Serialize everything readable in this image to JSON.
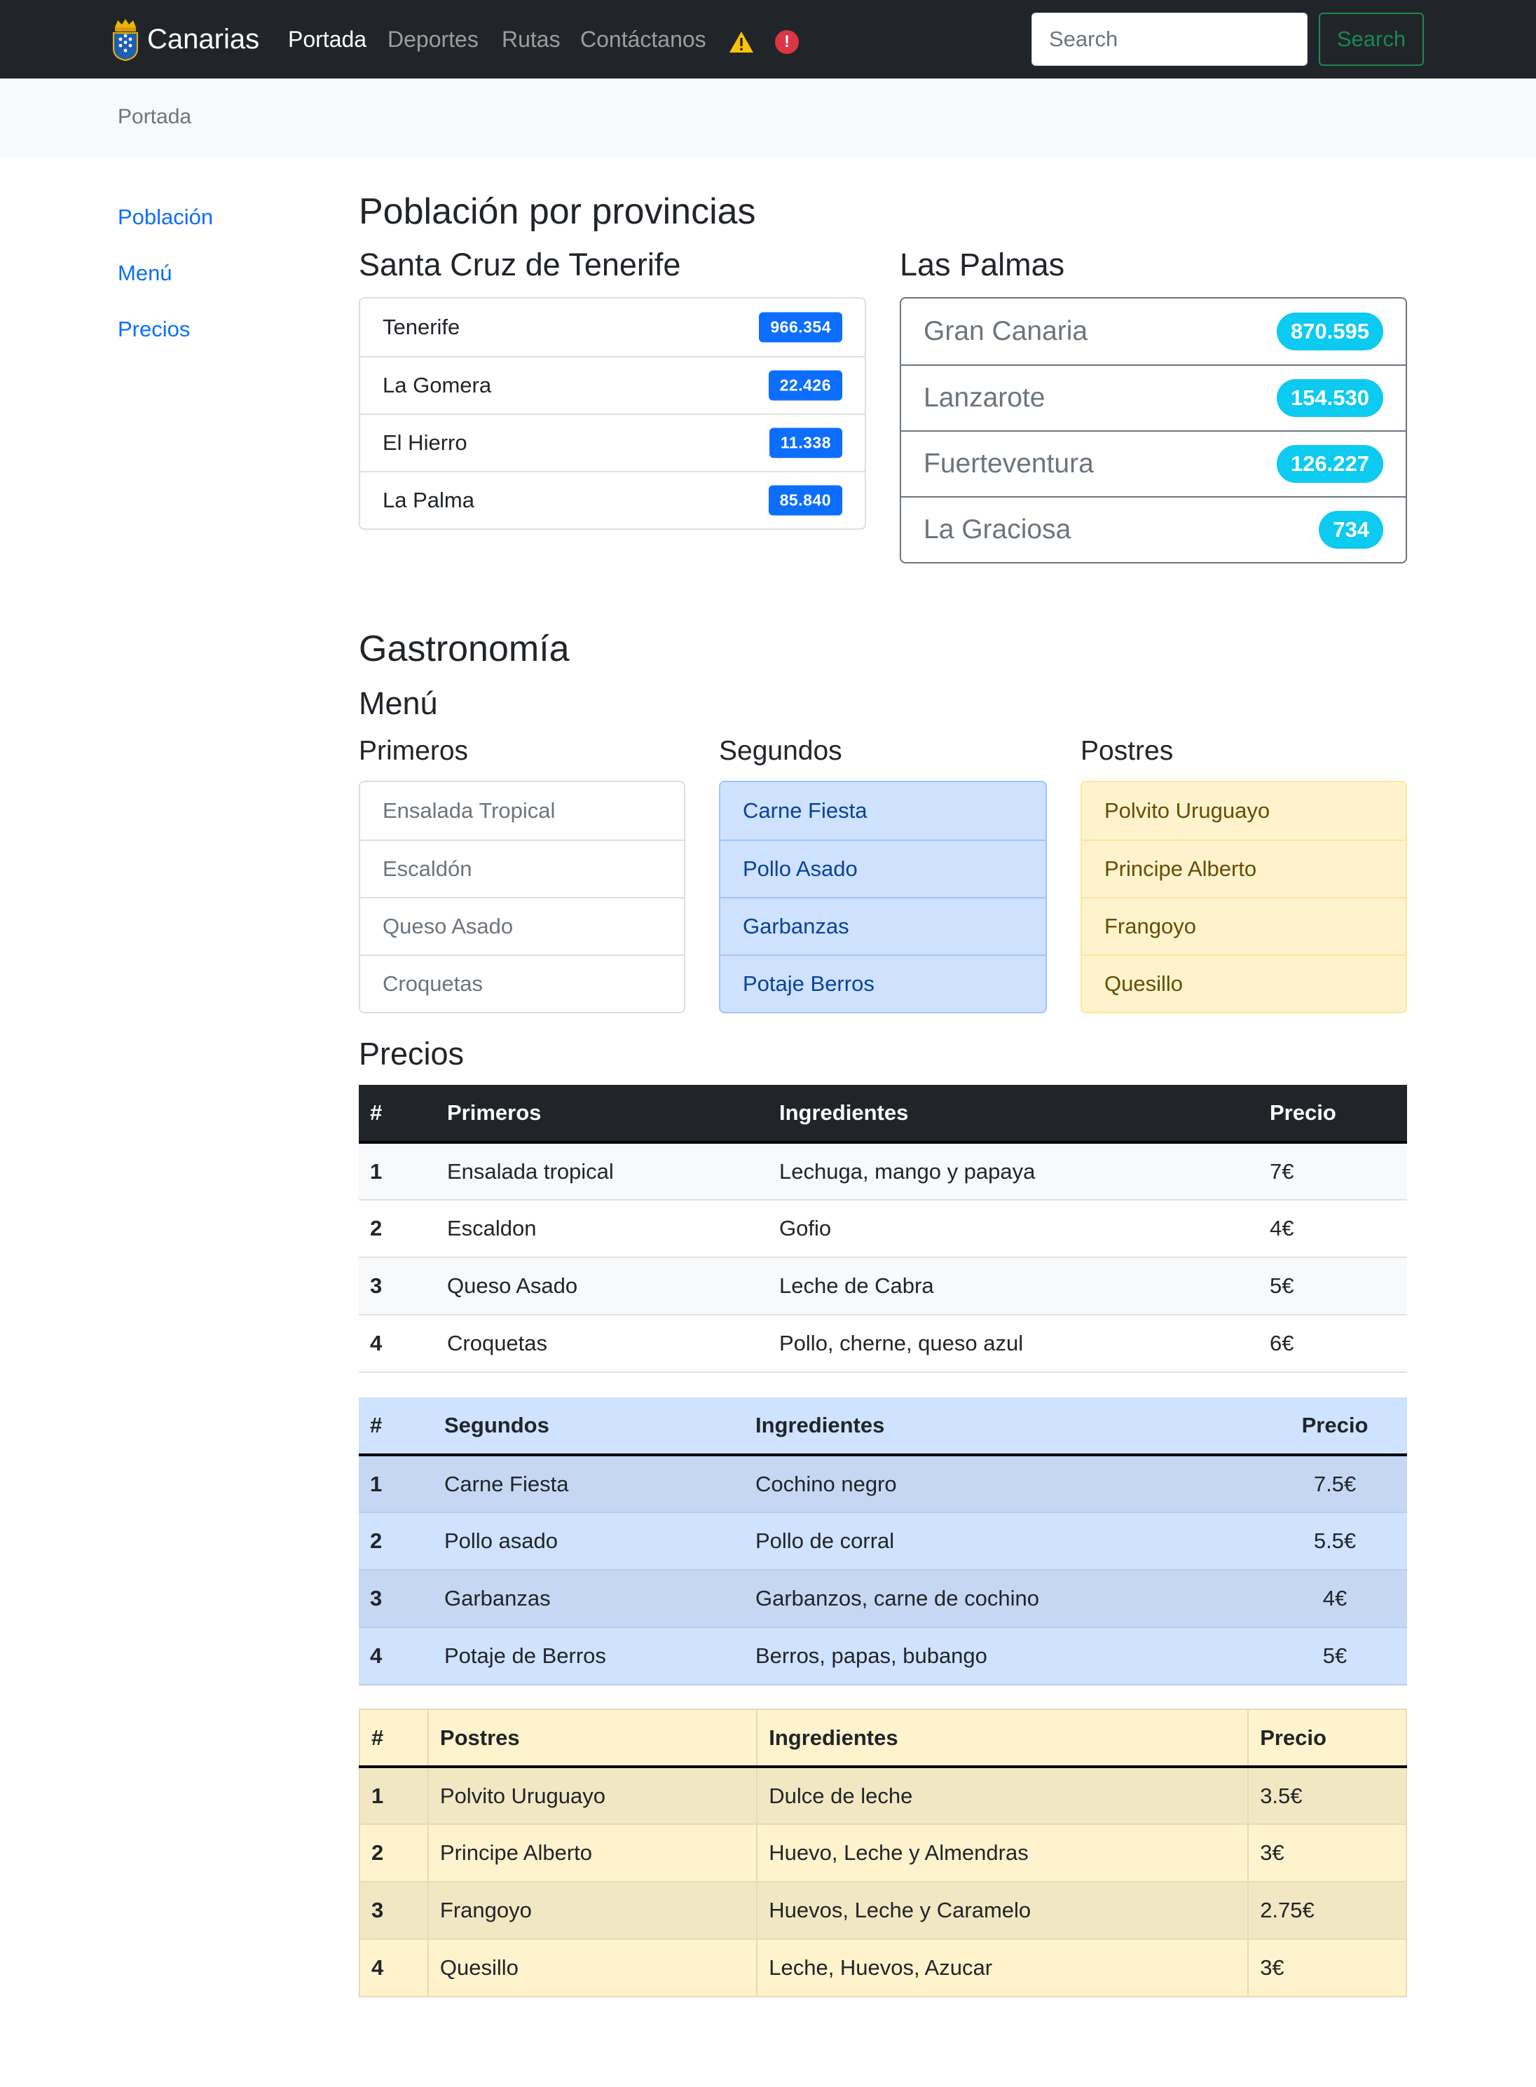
{
  "navbar": {
    "brand": "Canarias",
    "links": [
      "Portada",
      "Deportes",
      "Rutas",
      "Contáctanos"
    ],
    "search_placeholder": "Search",
    "search_button": "Search"
  },
  "breadcrumb": {
    "current": "Portada"
  },
  "sidebar": {
    "items": [
      "Población",
      "Menú",
      "Precios"
    ]
  },
  "poblacion": {
    "title": "Población por provincias",
    "provinces": [
      {
        "name": "Santa Cruz de Tenerife",
        "islands": [
          {
            "name": "Tenerife",
            "value": "966.354"
          },
          {
            "name": "La Gomera",
            "value": "22.426"
          },
          {
            "name": "El Hierro",
            "value": "11.338"
          },
          {
            "name": "La Palma",
            "value": "85.840"
          }
        ]
      },
      {
        "name": "Las Palmas",
        "islands": [
          {
            "name": "Gran Canaria",
            "value": "870.595"
          },
          {
            "name": "Lanzarote",
            "value": "154.530"
          },
          {
            "name": "Fuerteventura",
            "value": "126.227"
          },
          {
            "name": "La Graciosa",
            "value": "734"
          }
        ]
      }
    ]
  },
  "gastronomia": {
    "title": "Gastronomía",
    "menu_title": "Menú",
    "menu": [
      {
        "title": "Primeros",
        "items": [
          "Ensalada Tropical",
          "Escaldón",
          "Queso Asado",
          "Croquetas"
        ]
      },
      {
        "title": "Segundos",
        "items": [
          "Carne Fiesta",
          "Pollo Asado",
          "Garbanzas",
          "Potaje Berros"
        ]
      },
      {
        "title": "Postres",
        "items": [
          "Polvito Uruguayo",
          "Principe Alberto",
          "Frangoyo",
          "Quesillo"
        ]
      }
    ],
    "precios_title": "Precios",
    "tables": [
      {
        "headers": [
          "#",
          "Primeros",
          "Ingredientes",
          "Precio"
        ],
        "rows": [
          [
            "1",
            "Ensalada tropical",
            "Lechuga, mango y papaya",
            "7€"
          ],
          [
            "2",
            "Escaldon",
            "Gofio",
            "4€"
          ],
          [
            "3",
            "Queso Asado",
            "Leche de Cabra",
            "5€"
          ],
          [
            "4",
            "Croquetas",
            "Pollo, cherne, queso azul",
            "6€"
          ]
        ]
      },
      {
        "headers": [
          "#",
          "Segundos",
          "Ingredientes",
          "Precio"
        ],
        "rows": [
          [
            "1",
            "Carne Fiesta",
            "Cochino negro",
            "7.5€"
          ],
          [
            "2",
            "Pollo asado",
            "Pollo de corral",
            "5.5€"
          ],
          [
            "3",
            "Garbanzas",
            "Garbanzos, carne de cochino",
            "4€"
          ],
          [
            "4",
            "Potaje de Berros",
            "Berros, papas, bubango",
            "5€"
          ]
        ]
      },
      {
        "headers": [
          "#",
          "Postres",
          "Ingredientes",
          "Precio"
        ],
        "rows": [
          [
            "1",
            "Polvito Uruguayo",
            "Dulce de leche",
            "3.5€"
          ],
          [
            "2",
            "Principe Alberto",
            "Huevo, Leche y Almendras",
            "3€"
          ],
          [
            "3",
            "Frangoyo",
            "Huevos, Leche y Caramelo",
            "2.75€"
          ],
          [
            "4",
            "Quesillo",
            "Leche, Huevos, Azucar",
            "3€"
          ]
        ]
      }
    ]
  },
  "colors": {
    "navbar_bg": "#212529",
    "primary": "#0d6efd",
    "info": "#0dcaf0",
    "success": "#198754",
    "danger": "#dc3545",
    "warning": "#ffc107"
  },
  "icons": {
    "brand": "canarias-coat-of-arms-icon",
    "warning": "warning-triangle-icon",
    "alert": "exclamation-circle-icon"
  }
}
